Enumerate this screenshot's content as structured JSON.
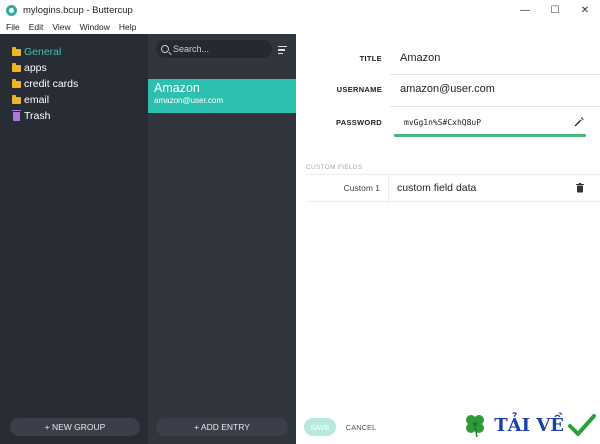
{
  "window": {
    "title": "mylogins.bcup - Buttercup",
    "minimize": "—",
    "maximize": "☐",
    "close": "✕"
  },
  "menu": [
    "File",
    "Edit",
    "View",
    "Window",
    "Help"
  ],
  "sidebar": {
    "groups": [
      {
        "label": "General",
        "icon": "folder-icon",
        "active": true
      },
      {
        "label": "apps",
        "icon": "folder-icon"
      },
      {
        "label": "credit cards",
        "icon": "folder-icon"
      },
      {
        "label": "email",
        "icon": "folder-icon"
      },
      {
        "label": "Trash",
        "icon": "trash-icon"
      }
    ],
    "new_group_label": "+ NEW GROUP"
  },
  "entries": {
    "search_placeholder": "Search...",
    "items": [
      {
        "title": "Amazon",
        "subtitle": "amazon@user.com"
      }
    ],
    "add_entry_label": "+ ADD ENTRY"
  },
  "details": {
    "title_label": "TITLE",
    "title_value": "Amazon",
    "username_label": "USERNAME",
    "username_value": "amazon@user.com",
    "password_label": "PASSWORD",
    "password_value": "mvGg1n%S#CxhQ8uP",
    "custom_fields_header": "CUSTOM FIELDS",
    "custom_fields": [
      {
        "label": "Custom 1",
        "value": "custom field data"
      }
    ],
    "save_label": "SAVE",
    "cancel_label": "CANCEL"
  },
  "watermark": {
    "text": "TẢI VỀ"
  },
  "colors": {
    "sidebar_bg": "#282c34",
    "entries_bg": "#31353e",
    "accent": "#2dbfaf",
    "password_strength": "#48b87a",
    "folder": "#f0b429"
  }
}
